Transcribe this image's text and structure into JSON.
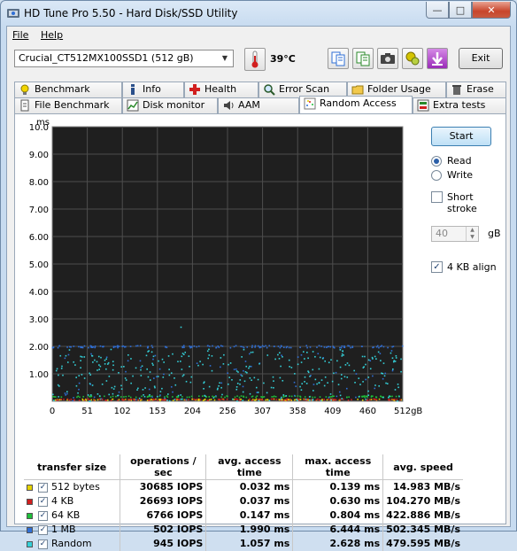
{
  "window": {
    "title": "HD Tune Pro 5.50 - Hard Disk/SSD Utility"
  },
  "menu": {
    "file": "File",
    "help": "Help"
  },
  "toolbar": {
    "drive": "Crucial_CT512MX100SSD1 (512 gB)",
    "temperature": "39°C",
    "exit_label": "Exit",
    "icons": [
      "copy-info-icon",
      "copy-text-icon",
      "camera-icon",
      "options-icon",
      "save-icon"
    ]
  },
  "tabs": {
    "row1": [
      "Benchmark",
      "Info",
      "Health",
      "Error Scan",
      "Folder Usage",
      "Erase"
    ],
    "row2": [
      "File Benchmark",
      "Disk monitor",
      "AAM",
      "Random Access",
      "Extra tests"
    ],
    "active": "Random Access"
  },
  "side": {
    "start_label": "Start",
    "read_label": "Read",
    "write_label": "Write",
    "mode": "Read",
    "short_stroke_label": "Short stroke",
    "short_stroke_checked": false,
    "stroke_value": "40",
    "stroke_unit": "gB",
    "align_label": "4 KB align",
    "align_checked": true
  },
  "chart_data": {
    "type": "scatter",
    "ylabel": "ms",
    "ylim": [
      0,
      10
    ],
    "xlim": [
      0,
      512
    ],
    "yticks": [
      "10.0",
      "9.00",
      "8.00",
      "7.00",
      "6.00",
      "5.00",
      "4.00",
      "3.00",
      "2.00",
      "1.00"
    ],
    "xticks": [
      "0",
      "51",
      "102",
      "153",
      "204",
      "256",
      "307",
      "358",
      "409",
      "460",
      "512gB"
    ],
    "grid": true,
    "series": [
      {
        "name": "512 bytes",
        "color": "#e4d200",
        "level_ms": 0.032,
        "max_ms": 0.139
      },
      {
        "name": "4 KB",
        "color": "#d11f1f",
        "level_ms": 0.037,
        "max_ms": 0.63
      },
      {
        "name": "64 KB",
        "color": "#1fbf3a",
        "level_ms": 0.147,
        "max_ms": 0.804
      },
      {
        "name": "1 MB",
        "color": "#2f6fd6",
        "level_ms": 1.99,
        "max_ms": 6.444
      },
      {
        "name": "Random",
        "color": "#34d0d8",
        "level_ms": 1.057,
        "max_ms": 2.628
      }
    ]
  },
  "results": {
    "headers": [
      "transfer size",
      "operations / sec",
      "avg. access time",
      "max. access time",
      "avg. speed"
    ],
    "rows": [
      {
        "color": "#e4d200",
        "size": "512 bytes",
        "ops": "30685 IOPS",
        "avg": "0.032 ms",
        "max": "0.139 ms",
        "speed": "14.983 MB/s"
      },
      {
        "color": "#d11f1f",
        "size": "4 KB",
        "ops": "26693 IOPS",
        "avg": "0.037 ms",
        "max": "0.630 ms",
        "speed": "104.270 MB/s"
      },
      {
        "color": "#1fbf3a",
        "size": "64 KB",
        "ops": "6766 IOPS",
        "avg": "0.147 ms",
        "max": "0.804 ms",
        "speed": "422.886 MB/s"
      },
      {
        "color": "#2f6fd6",
        "size": "1 MB",
        "ops": "502 IOPS",
        "avg": "1.990 ms",
        "max": "6.444 ms",
        "speed": "502.345 MB/s"
      },
      {
        "color": "#34d0d8",
        "size": "Random",
        "ops": "945 IOPS",
        "avg": "1.057 ms",
        "max": "2.628 ms",
        "speed": "479.595 MB/s"
      }
    ]
  }
}
